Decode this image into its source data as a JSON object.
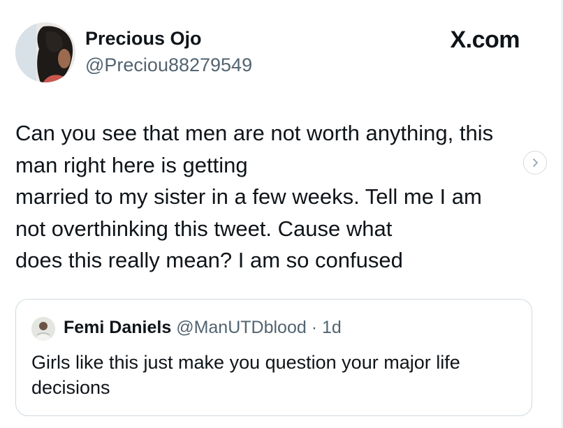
{
  "author": {
    "name": "Precious Ojo",
    "handle": "@Preciou88279549"
  },
  "brand": "X.com",
  "tweet": {
    "lines": [
      "Can you see that men are not worth anything, this",
      "man right here is getting",
      "married to my sister in a few weeks. Tell me I am",
      "not overthinking this tweet. Cause what",
      "does this really mean? I am so confused"
    ]
  },
  "quoted_tweet": {
    "name": "Femi Daniels",
    "handle": "@ManUTDblood",
    "separator": "·",
    "time": "1d",
    "text": "Girls like this just make you question your major life decisions"
  },
  "icons": {
    "next": "chevron-right-icon"
  },
  "colors": {
    "text_primary": "#0f1419",
    "text_secondary": "#536471",
    "card_border": "#cfd9de"
  }
}
